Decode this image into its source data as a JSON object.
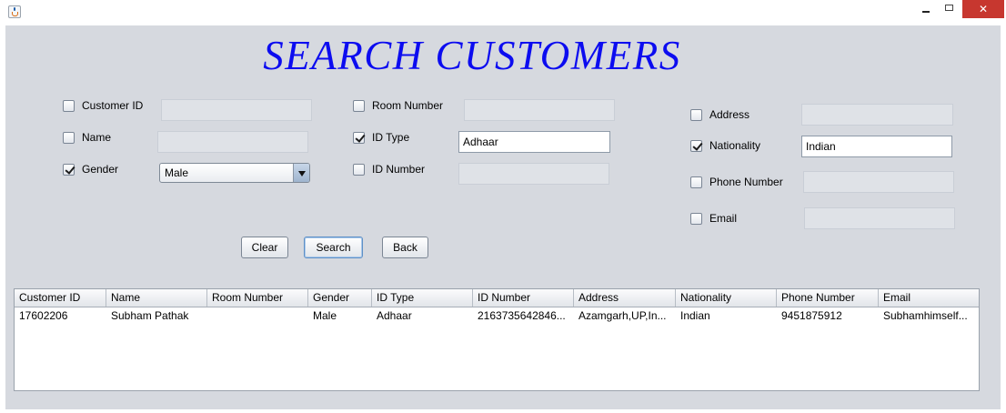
{
  "window": {
    "icon": "java-cup-icon",
    "controls": {
      "minimize": "minimize-icon",
      "maximize": "maximize-icon",
      "close": "close-icon"
    }
  },
  "page": {
    "title": "SEARCH CUSTOMERS",
    "title_color": "#0c0cf0",
    "panel_bg": "#d6d9df"
  },
  "filters": {
    "customer_id": {
      "label": "Customer ID",
      "checked": false,
      "value": ""
    },
    "name": {
      "label": "Name",
      "checked": false,
      "value": ""
    },
    "gender": {
      "label": "Gender",
      "checked": true,
      "selected": "Male"
    },
    "room_number": {
      "label": "Room Number",
      "checked": false,
      "value": ""
    },
    "id_type": {
      "label": "ID Type",
      "checked": true,
      "value": "Adhaar"
    },
    "id_number": {
      "label": "ID Number",
      "checked": false,
      "value": ""
    },
    "address": {
      "label": "Address",
      "checked": false,
      "value": ""
    },
    "nationality": {
      "label": "Nationality",
      "checked": true,
      "value": "Indian"
    },
    "phone_number": {
      "label": "Phone Number",
      "checked": false,
      "value": ""
    },
    "email": {
      "label": "Email",
      "checked": false,
      "value": ""
    }
  },
  "buttons": {
    "clear": "Clear",
    "search": "Search",
    "back": "Back"
  },
  "table": {
    "columns": [
      "Customer ID",
      "Name",
      "Room Number",
      "Gender",
      "ID Type",
      "ID Number",
      "Address",
      "Nationality",
      "Phone Number",
      "Email"
    ],
    "rows": [
      [
        "17602206",
        "Subham Pathak",
        "",
        "Male",
        "Adhaar",
        "2163735642846...",
        "Azamgarh,UP,In...",
        "Indian",
        "9451875912",
        "Subhamhimself..."
      ]
    ]
  }
}
